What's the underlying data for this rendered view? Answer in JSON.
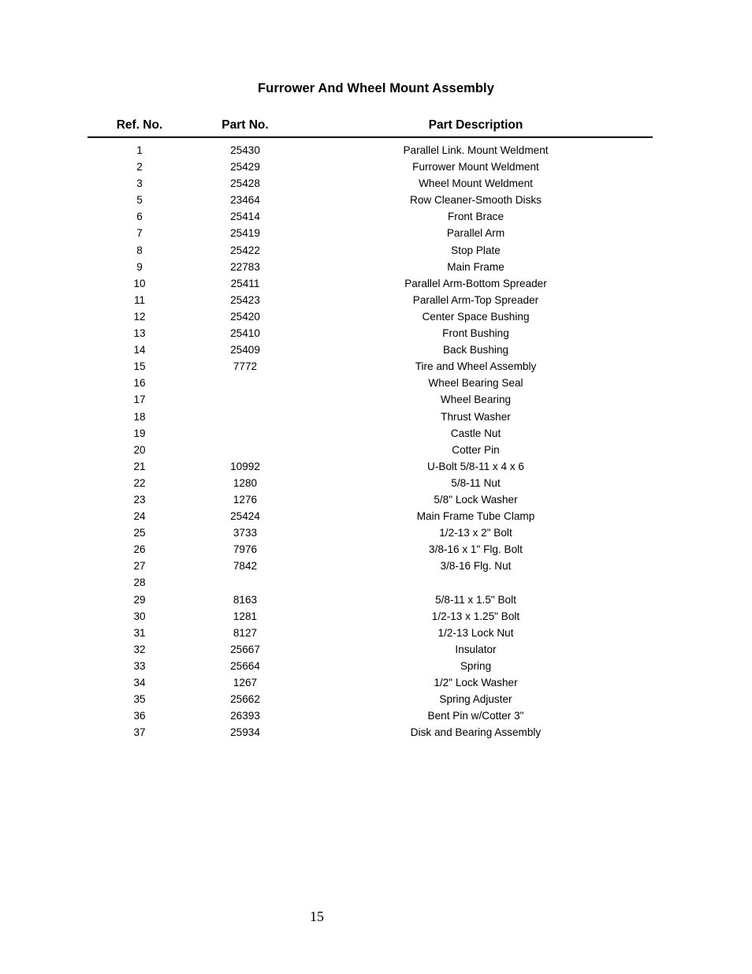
{
  "document": {
    "title": "Furrower And Wheel Mount Assembly",
    "page_number": "15"
  },
  "table": {
    "headers": {
      "ref_no": "Ref. No.",
      "part_no": "Part No.",
      "description": "Part Description"
    },
    "rows": [
      {
        "ref": "1",
        "part": "25430",
        "desc": "Parallel Link. Mount Weldment"
      },
      {
        "ref": "2",
        "part": "25429",
        "desc": "Furrower Mount Weldment"
      },
      {
        "ref": "3",
        "part": "25428",
        "desc": "Wheel Mount Weldment"
      },
      {
        "ref": "5",
        "part": "23464",
        "desc": "Row Cleaner-Smooth Disks"
      },
      {
        "ref": "6",
        "part": "25414",
        "desc": "Front Brace"
      },
      {
        "ref": "7",
        "part": "25419",
        "desc": "Parallel Arm"
      },
      {
        "ref": "8",
        "part": "25422",
        "desc": "Stop Plate"
      },
      {
        "ref": "9",
        "part": "22783",
        "desc": "Main Frame"
      },
      {
        "ref": "10",
        "part": "25411",
        "desc": "Parallel Arm-Bottom Spreader"
      },
      {
        "ref": "11",
        "part": "25423",
        "desc": "Parallel Arm-Top Spreader"
      },
      {
        "ref": "12",
        "part": "25420",
        "desc": "Center Space Bushing"
      },
      {
        "ref": "13",
        "part": "25410",
        "desc": "Front Bushing"
      },
      {
        "ref": "14",
        "part": "25409",
        "desc": "Back Bushing"
      },
      {
        "ref": "15",
        "part": "7772",
        "desc": "Tire and Wheel Assembly"
      },
      {
        "ref": "16",
        "part": "",
        "desc": "Wheel Bearing Seal"
      },
      {
        "ref": "17",
        "part": "",
        "desc": "Wheel Bearing"
      },
      {
        "ref": "18",
        "part": "",
        "desc": "Thrust Washer"
      },
      {
        "ref": "19",
        "part": "",
        "desc": "Castle Nut"
      },
      {
        "ref": "20",
        "part": "",
        "desc": "Cotter Pin"
      },
      {
        "ref": "21",
        "part": "10992",
        "desc": "U-Bolt 5/8-11 x 4 x 6"
      },
      {
        "ref": "22",
        "part": "1280",
        "desc": "5/8-11 Nut"
      },
      {
        "ref": "23",
        "part": "1276",
        "desc": "5/8\" Lock Washer"
      },
      {
        "ref": "24",
        "part": "25424",
        "desc": "Main Frame Tube Clamp"
      },
      {
        "ref": "25",
        "part": "3733",
        "desc": "1/2-13 x 2\" Bolt"
      },
      {
        "ref": "26",
        "part": "7976",
        "desc": "3/8-16 x 1\" Flg. Bolt"
      },
      {
        "ref": "27",
        "part": "7842",
        "desc": "3/8-16 Flg. Nut"
      },
      {
        "ref": "28",
        "part": "",
        "desc": ""
      },
      {
        "ref": "29",
        "part": "8163",
        "desc": "5/8-11 x 1.5\" Bolt"
      },
      {
        "ref": "30",
        "part": "1281",
        "desc": "1/2-13 x 1.25\" Bolt"
      },
      {
        "ref": "31",
        "part": "8127",
        "desc": "1/2-13 Lock Nut"
      },
      {
        "ref": "32",
        "part": "25667",
        "desc": "Insulator"
      },
      {
        "ref": "33",
        "part": "25664",
        "desc": "Spring"
      },
      {
        "ref": "34",
        "part": "1267",
        "desc": "1/2\" Lock Washer"
      },
      {
        "ref": "35",
        "part": "25662",
        "desc": "Spring Adjuster"
      },
      {
        "ref": "36",
        "part": "26393",
        "desc": "Bent Pin w/Cotter 3\""
      },
      {
        "ref": "37",
        "part": "25934",
        "desc": "Disk and Bearing Assembly"
      }
    ]
  }
}
